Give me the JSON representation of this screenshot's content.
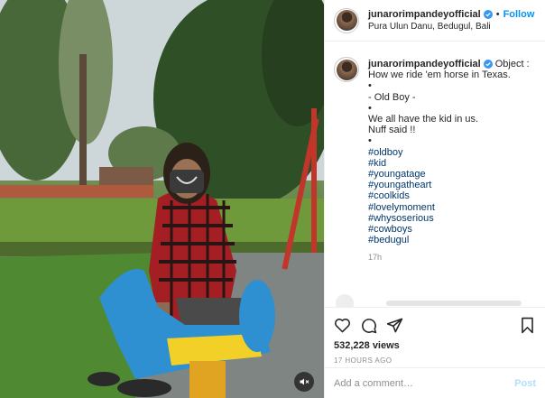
{
  "post": {
    "author": "junarorimpandeyofficial",
    "follow_label": "Follow",
    "dot": "•",
    "location": "Pura Ulun Danu, Bedugul, Bali"
  },
  "caption": {
    "author": "junarorimpandeyofficial",
    "lines": [
      "Object :",
      "How we ride 'em horse in Texas.",
      "•",
      "- Old Boy -",
      "•",
      "We all have the kid in us.",
      "Nuff said !!",
      "•"
    ],
    "hashtags": [
      "#oldboy",
      "#kid",
      "#youngatage",
      "#youngatheart",
      "#coolkids",
      "#lovelymoment",
      "#whysoserious",
      "#cowboys",
      "#bedugul"
    ],
    "time_ago": "17h"
  },
  "stats": {
    "views": "532,228 views",
    "posted": "17 HOURS AGO"
  },
  "comment": {
    "placeholder": "Add a comment…",
    "post_label": "Post"
  },
  "icons": {
    "like": "heart-icon",
    "comment": "comment-icon",
    "share": "share-icon",
    "save": "bookmark-icon",
    "mute": "speaker-muted-icon",
    "verified": "verified-badge-icon"
  },
  "colors": {
    "link_blue": "#0095f6",
    "hashtag": "#00376b",
    "meta_gray": "#8e8e8e"
  }
}
